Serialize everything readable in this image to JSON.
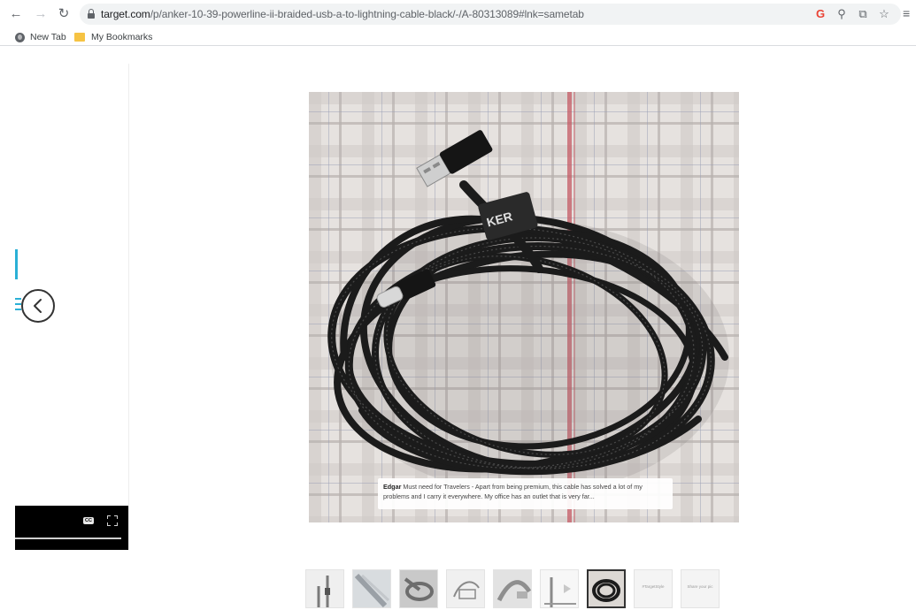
{
  "browser": {
    "url_host": "target.com",
    "url_path": "/p/anker-10-39-powerline-ii-braided-usb-a-to-lightning-cable-black/-/A-80313089#lnk=sametab",
    "icons": [
      "back-icon",
      "forward-icon",
      "reload-icon",
      "lock-icon",
      "google-icon",
      "zoom-icon",
      "share-icon",
      "star-icon",
      "menu-icon"
    ]
  },
  "bookmarks": {
    "items": [
      {
        "label": "New Tab",
        "icon": "globe-icon"
      },
      {
        "label": "My Bookmarks",
        "icon": "folder-icon"
      }
    ]
  },
  "gallery": {
    "review": {
      "author": "Edgar",
      "text": "Must need for Travelers - Apart from being premium, this cable has solved a lot of my problems and I carry it everywhere. My office has an outlet that is very far..."
    },
    "thumbnails": [
      {
        "label": ""
      },
      {
        "label": ""
      },
      {
        "label": ""
      },
      {
        "label": ""
      },
      {
        "label": ""
      },
      {
        "label": ""
      },
      {
        "label": "",
        "selected": true
      },
      {
        "label": "#TargetStyle"
      },
      {
        "label": "Share your pic"
      }
    ],
    "video_controls": {
      "cc_label": "CC"
    }
  },
  "colors": {
    "accent_blue": "#2bb0d6",
    "cable_black": "#1b1b1b"
  }
}
